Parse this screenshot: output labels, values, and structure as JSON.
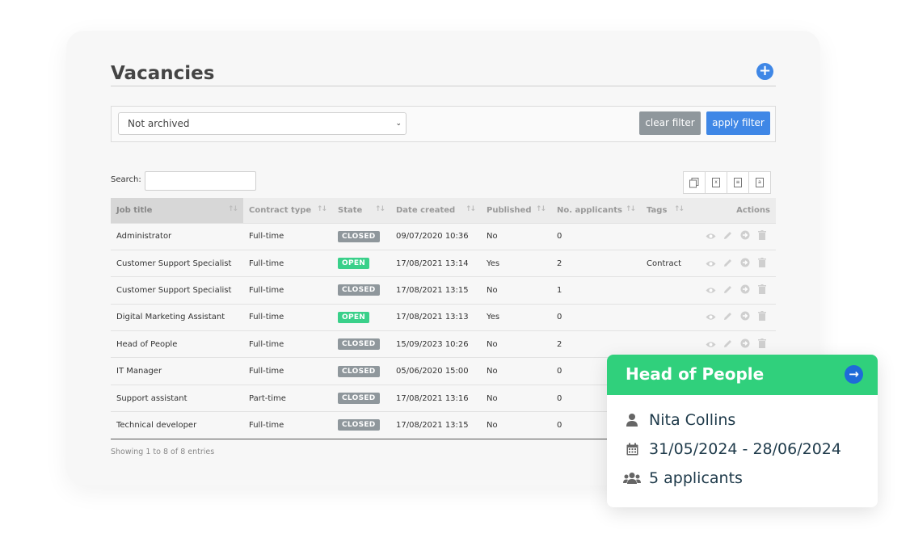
{
  "page": {
    "title": "Vacancies",
    "add_icon": "plus-icon"
  },
  "filter": {
    "archive_value": "Not archived",
    "clear_label": "clear filter",
    "apply_label": "apply filter"
  },
  "search": {
    "label": "Search:",
    "value": ""
  },
  "export_icons": [
    "copy-icon",
    "excel-icon",
    "csv-icon",
    "pdf-icon"
  ],
  "table": {
    "headers": [
      "Job title",
      "Contract type",
      "State",
      "Date created",
      "Published",
      "No. applicants",
      "Tags",
      "Actions"
    ],
    "rows": [
      {
        "title": "Administrator",
        "contract": "Full-time",
        "state": "CLOSED",
        "date": "09/07/2020 10:36",
        "published": "No",
        "applicants": "0",
        "tags": ""
      },
      {
        "title": "Customer Support Specialist",
        "contract": "Full-time",
        "state": "OPEN",
        "date": "17/08/2021 13:14",
        "published": "Yes",
        "applicants": "2",
        "tags": "Contract"
      },
      {
        "title": "Customer Support Specialist",
        "contract": "Full-time",
        "state": "CLOSED",
        "date": "17/08/2021 13:15",
        "published": "No",
        "applicants": "1",
        "tags": ""
      },
      {
        "title": "Digital Marketing Assistant",
        "contract": "Full-time",
        "state": "OPEN",
        "date": "17/08/2021 13:13",
        "published": "Yes",
        "applicants": "0",
        "tags": ""
      },
      {
        "title": "Head of People",
        "contract": "Full-time",
        "state": "CLOSED",
        "date": "15/09/2023 10:26",
        "published": "No",
        "applicants": "2",
        "tags": ""
      },
      {
        "title": "IT Manager",
        "contract": "Full-time",
        "state": "CLOSED",
        "date": "05/06/2020 15:00",
        "published": "No",
        "applicants": "0",
        "tags": ""
      },
      {
        "title": "Support assistant",
        "contract": "Part-time",
        "state": "CLOSED",
        "date": "17/08/2021 13:16",
        "published": "No",
        "applicants": "0",
        "tags": ""
      },
      {
        "title": "Technical developer",
        "contract": "Full-time",
        "state": "CLOSED",
        "date": "17/08/2021 13:15",
        "published": "No",
        "applicants": "0",
        "tags": ""
      }
    ]
  },
  "footer": {
    "showing": "Showing 1 to 8 of 8 entries"
  },
  "popup": {
    "title": "Head of People",
    "person": "Nita Collins",
    "dates": "31/05/2024 - 28/06/2024",
    "applicants": "5 applicants"
  },
  "colors": {
    "accent_blue": "#3f87e6",
    "open_green": "#3ad08a",
    "closed_grey": "#8f979c",
    "popup_green": "#30d07c"
  }
}
